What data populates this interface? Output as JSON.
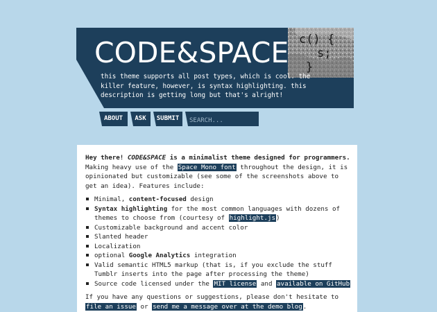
{
  "header": {
    "logo": "CODE&SPACE",
    "avatar_lines": [
      "c() {",
      "s;",
      "}"
    ],
    "description": "this theme supports all post types, which is cool. the killer feature, however, is syntax highlighting. this description is getting long but that's alright!"
  },
  "nav": {
    "about": "ABOUT",
    "ask": "ASK",
    "submit": "SUBMIT",
    "search_placeholder": "SEARCH..."
  },
  "post": {
    "intro_greeting": "Hey there!",
    "intro_brand": "CODE&SPACE",
    "intro_bold_rest": " is a minimalist theme designed for programmers.",
    "intro_1": " Making heavy use of the ",
    "font_link": "Space Mono font",
    "intro_2": " throughout the design, it is opinionated but customizable (see some of the screenshots above to get an idea). Features include:",
    "features": [
      {
        "pre": "Minimal, ",
        "bold": "content-focused",
        "post": " design"
      },
      {
        "pre": "",
        "bold": "Syntax highlighting",
        "post": " for the most common languages with dozens of themes to choose from (courtesy of ",
        "link": "highlight.js",
        "after": ")"
      },
      {
        "pre": "Customizable background and accent color",
        "bold": "",
        "post": ""
      },
      {
        "pre": "Slanted header",
        "bold": "",
        "post": ""
      },
      {
        "pre": "Localization",
        "bold": "",
        "post": ""
      },
      {
        "pre": "optional ",
        "bold": "Google Analytics",
        "post": " integration"
      },
      {
        "pre": "Valid semantic HTML5 markup (that is, if you exclude the stuff Tumblr inserts into the page after processing the theme)",
        "bold": "",
        "post": ""
      },
      {
        "pre": "Source code licensed under the ",
        "bold": "",
        "link": "MIT license",
        "mid": " and ",
        "link2": "available on GitHub",
        "post": ""
      }
    ],
    "outro_1": "If you have any questions or suggestions, please don't hesitate to ",
    "outro_link1": "file an issue",
    "outro_2": " or ",
    "outro_link2": "send me a message over at the demo blog",
    "outro_3": "."
  },
  "colors": {
    "background": "#b8d7ea",
    "accent": "#1d3f5b",
    "card": "#ffffff"
  }
}
